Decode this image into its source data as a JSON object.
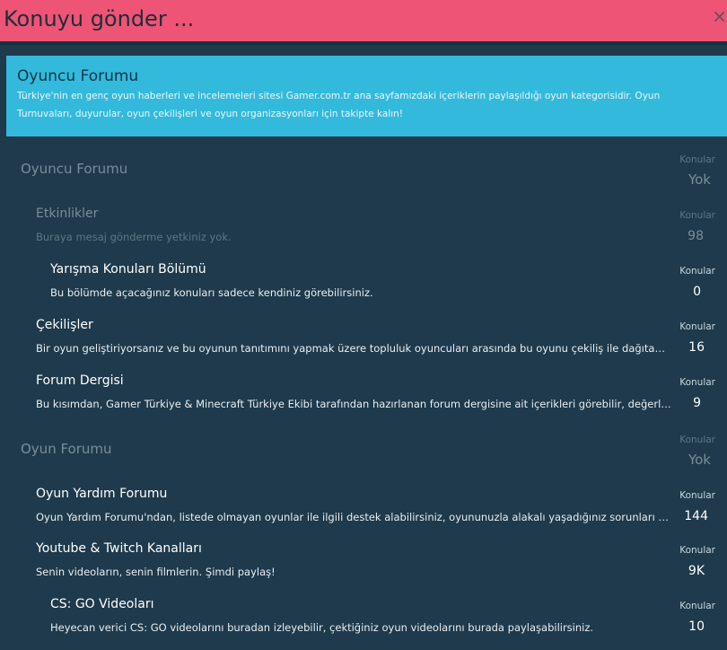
{
  "dialog": {
    "title": "Konuyu gönder ...",
    "close_glyph": "×"
  },
  "banner": {
    "title": "Oyuncu Forumu",
    "description": "Türkiye'nin en genç oyun haberleri ve incelemeleri sitesi Gamer.com.tr ana sayfamızdaki içeriklerin paylaşıldığı oyun kategorisidir. Oyun Turnuvaları, duyurular, oyun çekilişleri ve oyun organizasyonları için takipte kalın!"
  },
  "forums": [
    {
      "name": "Oyuncu Forumu",
      "description": "",
      "stat_label": "Konular",
      "stat_value": "Yok"
    },
    {
      "name": "Etkinlikler",
      "description": "Buraya mesaj gönderme yetkiniz yok.",
      "stat_label": "Konular",
      "stat_value": "98"
    },
    {
      "name": "Yarışma Konuları Bölümü",
      "description": "Bu bölümde açacağınız konuları sadece kendiniz görebilirsiniz.",
      "stat_label": "Konular",
      "stat_value": "0"
    },
    {
      "name": "Çekilişler",
      "description": "Bir oyun geliştiriyorsanız ve bu oyunun tanıtımını yapmak üzere topluluk oyuncuları arasında bu oyunu çekiliş ile dağıtabilirsiniz.",
      "stat_label": "Konular",
      "stat_value": "16"
    },
    {
      "name": "Forum Dergisi",
      "description": "Bu kısımdan, Gamer Türkiye & Minecraft Türkiye Ekibi tarafından hazırlanan forum dergisine ait içerikleri görebilir, değerlendirebilirsiniz.",
      "stat_label": "Konular",
      "stat_value": "9"
    },
    {
      "name": "Oyun Forumu",
      "description": "",
      "stat_label": "Konular",
      "stat_value": "Yok"
    },
    {
      "name": "Oyun Yardım Forumu",
      "description": "Oyun Yardım Forumu'ndan, listede olmayan oyunlar ile ilgili destek alabilirsiniz, oyununuzla alakalı yaşadığınız sorunları paylaşabilirsiniz.",
      "stat_label": "Konular",
      "stat_value": "144"
    },
    {
      "name": "Youtube & Twitch Kanalları",
      "description": "Senin videoların, senin filmlerin. Şimdi paylaş!",
      "stat_label": "Konular",
      "stat_value": "9K"
    },
    {
      "name": "CS: GO Videoları",
      "description": "Heyecan verici CS: GO videolarını buradan izleyebilir, çektiğiniz oyun videolarını burada paylaşabilirsiniz.",
      "stat_label": "Konular",
      "stat_value": "10"
    }
  ],
  "colors": {
    "header_bg": "#ee5475",
    "banner_bg": "#33b9db",
    "page_bg": "#1e3a4c"
  }
}
